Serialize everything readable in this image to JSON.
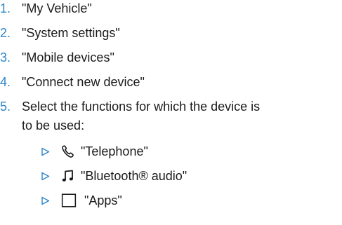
{
  "steps": [
    {
      "number": "1.",
      "text": "\"My Vehicle\""
    },
    {
      "number": "2.",
      "text": "\"System settings\""
    },
    {
      "number": "3.",
      "text": "\"Mobile devices\""
    },
    {
      "number": "4.",
      "text": "\"Connect new device\""
    },
    {
      "number": "5.",
      "text_line1": "Select the functions for which the device is",
      "text_line2": "to be used:"
    }
  ],
  "functions": [
    {
      "icon": "telephone-handset-icon",
      "text": "\"Telephone\""
    },
    {
      "icon": "music-note-icon",
      "text": "\"Bluetooth® audio\""
    },
    {
      "icon": "apps-square-icon",
      "text": "\"Apps\""
    }
  ],
  "colors": {
    "step_number": "#2f86c8",
    "bullet_triangle": "#2f86c8",
    "text": "#1a1a1a"
  }
}
